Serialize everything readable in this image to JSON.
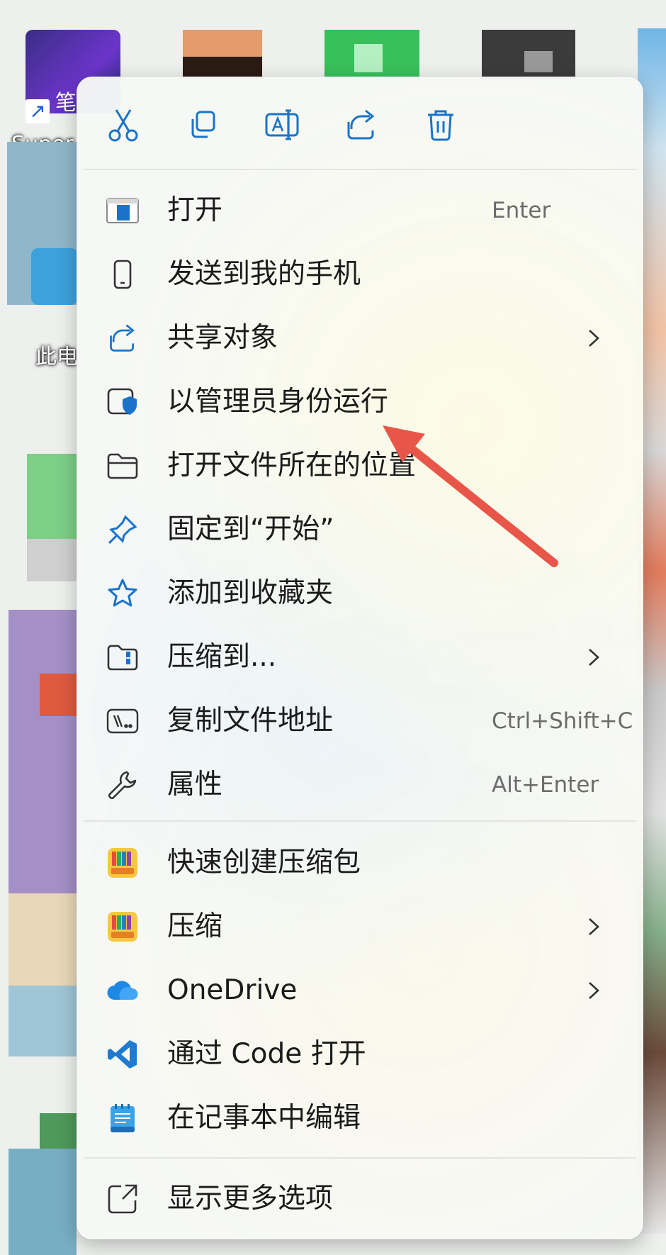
{
  "desktop": {
    "icons": [
      {
        "label": "Super"
      },
      {
        "label": "此电"
      }
    ],
    "shortcut_glyph": "笔"
  },
  "toolbar": {
    "buttons": [
      {
        "icon": "cut-icon"
      },
      {
        "icon": "copy-icon"
      },
      {
        "icon": "rename-icon"
      },
      {
        "icon": "share-icon"
      },
      {
        "icon": "delete-icon"
      }
    ]
  },
  "menu": {
    "items": [
      {
        "label": "打开",
        "shortcut": "Enter",
        "icon": "open-app-icon"
      },
      {
        "label": "发送到我的手机",
        "shortcut": "",
        "icon": "phone-icon"
      },
      {
        "label": "共享对象",
        "shortcut": "",
        "icon": "share-icon",
        "submenu": true
      },
      {
        "label": "以管理员身份运行",
        "shortcut": "",
        "icon": "shield-icon"
      },
      {
        "label": "打开文件所在的位置",
        "shortcut": "",
        "icon": "folder-icon"
      },
      {
        "label": "固定到“开始”",
        "shortcut": "",
        "icon": "pin-icon"
      },
      {
        "label": "添加到收藏夹",
        "shortcut": "",
        "icon": "star-icon"
      },
      {
        "label": "压缩到...",
        "shortcut": "",
        "icon": "zip-folder-icon",
        "submenu": true
      },
      {
        "label": "复制文件地址",
        "shortcut": "Ctrl+Shift+C",
        "icon": "path-icon"
      },
      {
        "label": "属性",
        "shortcut": "Alt+Enter",
        "icon": "wrench-icon"
      },
      {
        "label": "快速创建压缩包",
        "shortcut": "",
        "icon": "bandizip-icon"
      },
      {
        "label": "压缩",
        "shortcut": "",
        "icon": "bandizip-icon",
        "submenu": true
      },
      {
        "label": "OneDrive",
        "shortcut": "",
        "icon": "onedrive-icon",
        "submenu": true
      },
      {
        "label": "通过 Code 打开",
        "shortcut": "",
        "icon": "vscode-icon"
      },
      {
        "label": "在记事本中编辑",
        "shortcut": "",
        "icon": "notepad-icon"
      },
      {
        "label": "显示更多选项",
        "shortcut": "",
        "icon": "more-options-icon"
      }
    ]
  },
  "colors": {
    "accent": "#1a73c8",
    "annotation_arrow": "#e8564a",
    "menu_bg": "#f6f8f6"
  }
}
